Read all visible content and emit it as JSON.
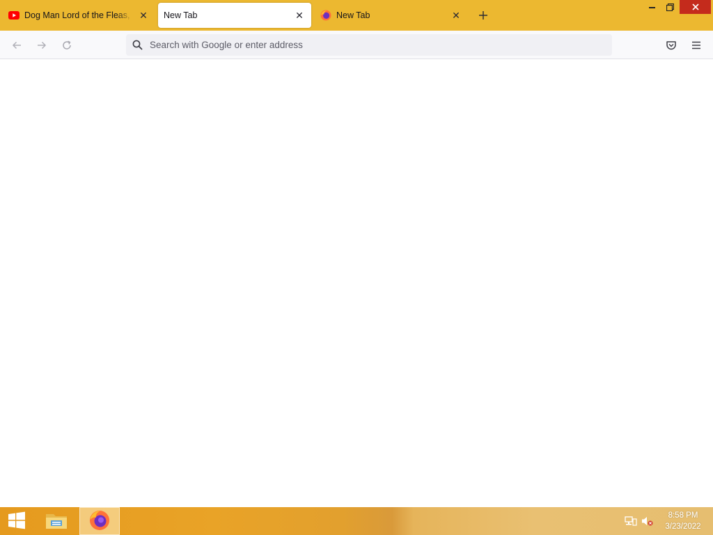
{
  "browser": {
    "tabs": [
      {
        "title": "Dog Man Lord of the Fleas, Read",
        "favicon": "youtube-icon",
        "active": false
      },
      {
        "title": "New Tab",
        "favicon": "none",
        "active": true
      },
      {
        "title": "New Tab",
        "favicon": "firefox-icon",
        "active": false
      }
    ],
    "new_tab_icon": "plus-icon",
    "window_controls": [
      "minimize-icon",
      "restore-icon",
      "close-icon"
    ],
    "toolbar": {
      "back_icon": "arrow-left-icon",
      "forward_icon": "arrow-right-icon",
      "reload_icon": "reload-icon",
      "address_placeholder": "Search with Google or enter address",
      "address_value": "",
      "pocket_icon": "pocket-icon",
      "menu_icon": "hamburger-menu-icon"
    },
    "colors": {
      "tab_strip": "#ecb830",
      "toolbar": "#f9f9fb",
      "urlbar": "#f0f0f4",
      "close_button": "#c42b1c"
    }
  },
  "taskbar": {
    "pinned": [
      {
        "name": "start",
        "icon": "windows-logo-icon"
      },
      {
        "name": "file-explorer",
        "icon": "folder-icon"
      },
      {
        "name": "firefox",
        "icon": "firefox-icon",
        "active": true
      }
    ],
    "tray": [
      "network-icon",
      "volume-muted-icon"
    ],
    "clock": {
      "time": "8:58 PM",
      "date": "3/23/2022"
    }
  }
}
